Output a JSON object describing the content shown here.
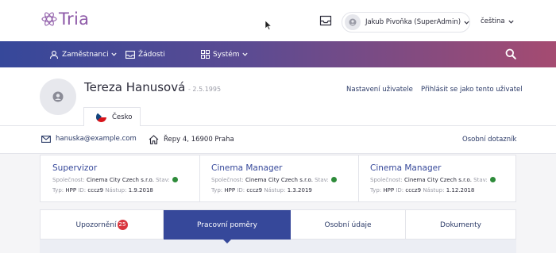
{
  "app": {
    "logo_text": "Tria",
    "brand_color": "#8e5aa8"
  },
  "header": {
    "user_name": "Jakub Pivoňka (SuperAdmin)",
    "language": "čeština"
  },
  "nav": {
    "items": [
      {
        "label": "Zaměstnanci",
        "icon": "users-icon"
      },
      {
        "label": "Žádosti",
        "icon": "mail-icon"
      },
      {
        "label": "Systém",
        "icon": "grid-icon"
      }
    ]
  },
  "profile": {
    "name": "Tereza Hanusová",
    "dob": "- 2.5.1995",
    "settings_link": "Nastavení uživatele",
    "login_as_link": "Přihlásit se jako tento uživatel",
    "country_tab": "Česko"
  },
  "contact": {
    "email": "hanuska@example.com",
    "address": "Řepy 4, 16900 Praha",
    "questionnaire_link": "Osobní dotazník"
  },
  "positions": [
    {
      "title": "Supervizor",
      "company_label": "Společnost:",
      "company": "Cinema City Czech s.r.o.",
      "status_label": "Stav:",
      "type_label": "Typ:",
      "type": "HPP",
      "id_label": "ID:",
      "id": "cccz9",
      "start_label": "Nástup:",
      "start": "1.9.2018"
    },
    {
      "title": "Cinema Manager",
      "company_label": "Společnost:",
      "company": "Cinema City Czech s.r.o.",
      "status_label": "Stav:",
      "type_label": "Typ:",
      "type": "HPP",
      "id_label": "ID:",
      "id": "cccz9",
      "start_label": "Nástup:",
      "start": "1.3.2019"
    },
    {
      "title": "Cinema Manager",
      "company_label": "Společnost:",
      "company": "Cinema City Czech s.r.o.",
      "status_label": "Stav:",
      "type_label": "Typ:",
      "type": "HPP",
      "id_label": "ID:",
      "id": "cccz9",
      "start_label": "Nástup:",
      "start": "1.12.2018"
    }
  ],
  "tabs": [
    {
      "label": "Upozornění",
      "badge": "25"
    },
    {
      "label": "Pracovní poměry"
    },
    {
      "label": "Osobní údaje"
    },
    {
      "label": "Dokumenty"
    }
  ],
  "colors": {
    "primary": "#36489a",
    "status_active": "#2e8b3a",
    "badge": "#d9363e"
  }
}
